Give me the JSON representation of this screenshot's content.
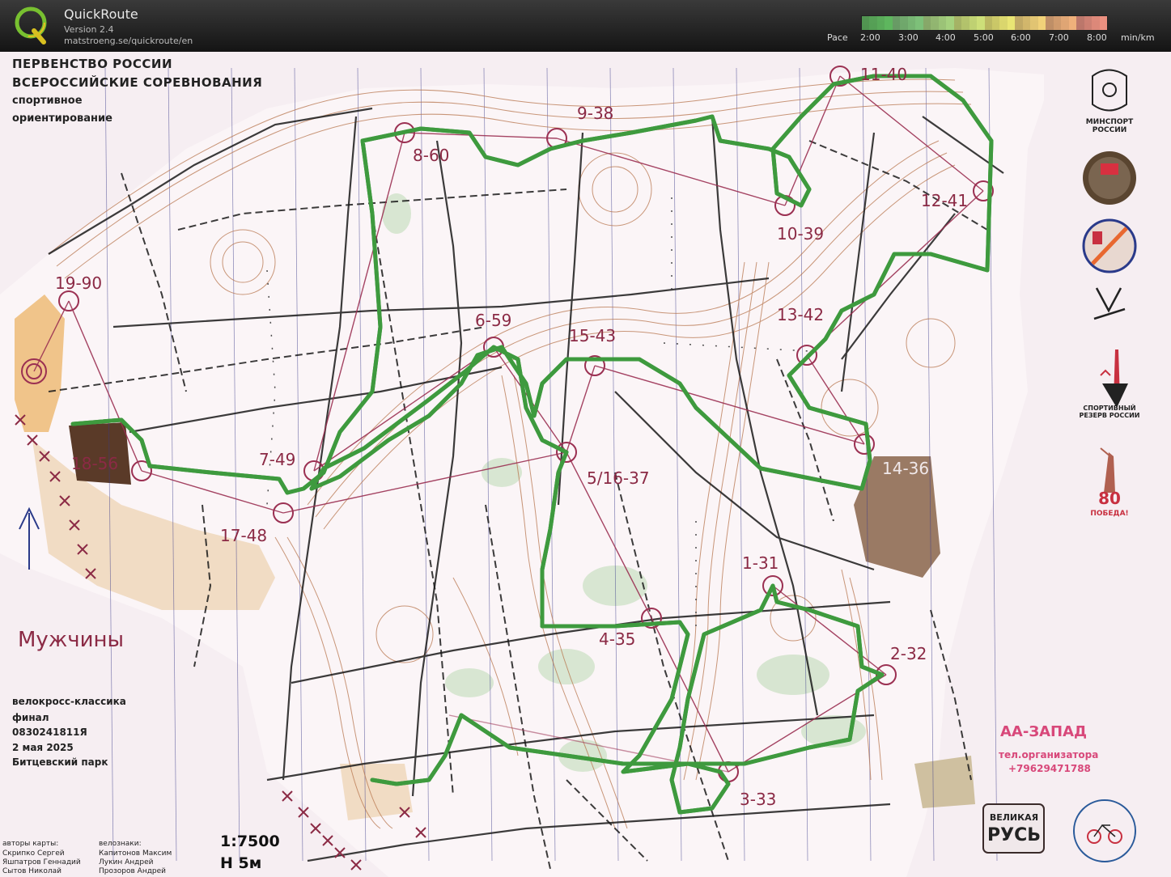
{
  "app": {
    "title": "QuickRoute",
    "version": "Version 2.4",
    "url": "matstroeng.se/quickroute/en"
  },
  "pace_legend": {
    "label": "Pace",
    "ticks": [
      "2:00",
      "3:00",
      "4:00",
      "5:00",
      "6:00",
      "7:00",
      "8:00"
    ],
    "unit": "min/km",
    "colors": [
      "#5fb85f",
      "#7ec27a",
      "#a7d37f",
      "#cfe27a",
      "#ece875",
      "#f4d47a",
      "#f2b27c",
      "#ee9282"
    ]
  },
  "map": {
    "title_line1": "ПЕРВЕНСТВО РОССИИ",
    "title_line2": "ВСЕРОССИЙСКИЕ СОРЕВНОВАНИЯ",
    "title_line3": "спортивное",
    "title_line4": "ориентирование",
    "class": "Мужчины",
    "discipline": "велокросс-классика",
    "stage": "финал",
    "code": "0830241811Я",
    "date": "2 мая 2025",
    "venue": "Битцевский парк",
    "scale": "1:7500",
    "contour": "Н 5м",
    "map_authors_label": "авторы карты:",
    "map_authors": [
      "Скрипко Сергей",
      "Яшпатров Геннадий",
      "Сытов Николай"
    ],
    "bike_signs_label": "велознаки:",
    "bike_signs": [
      "Капитонов Максим",
      "Лукин Андрей",
      "Прозоров Андрей"
    ],
    "organizer": "АА-ЗАПАД",
    "organizer_tel_label": "тел.организатора",
    "organizer_phone": "+79629471788",
    "sponsors": {
      "minsport_line1": "МИНСПОРТ",
      "minsport_line2": "РОССИИ",
      "reserve_line1": "СПОРТИВНЫЙ",
      "reserve_line2": "РЕЗЕРВ РОССИИ",
      "victory_80": "80",
      "victory": "ПОБЕДА!",
      "velikaya": "ВЕЛИКАЯ",
      "rus": "РУСЬ"
    },
    "controls": [
      {
        "label": "1-31"
      },
      {
        "label": "2-32"
      },
      {
        "label": "3-33"
      },
      {
        "label": "4-35"
      },
      {
        "label": "5/16-37"
      },
      {
        "label": "6-59"
      },
      {
        "label": "7-49"
      },
      {
        "label": "8-60"
      },
      {
        "label": "9-38"
      },
      {
        "label": "10-39"
      },
      {
        "label": "11-40"
      },
      {
        "label": "12-41"
      },
      {
        "label": "13-42"
      },
      {
        "label": "14-36"
      },
      {
        "label": "15-43"
      },
      {
        "label": "17-48"
      },
      {
        "label": "18-56"
      },
      {
        "label": "19-90"
      }
    ],
    "colors": {
      "paper": "#f6eef2",
      "course": "#9b3052",
      "contour": "#b8764e",
      "route_green": "#3e9a3e",
      "route_yellow": "#e8e24a",
      "open_land": "#f1c890",
      "building": "#5a3a28"
    }
  }
}
